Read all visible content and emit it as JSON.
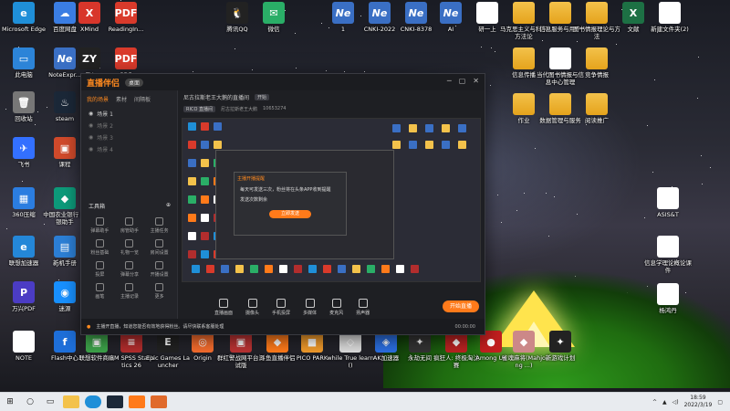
{
  "desktop": {
    "icons": [
      {
        "label": "Microsoft Edge",
        "glyph": "e",
        "cls": "",
        "color": "#1f8fd8"
      },
      {
        "label": "百度网盘",
        "glyph": "☁",
        "cls": "",
        "color": "#3a7de3"
      },
      {
        "label": "XMind",
        "glyph": "X",
        "cls": "",
        "color": "#d8362b"
      },
      {
        "label": "ReadingIn...",
        "glyph": "PDF",
        "cls": "pdf",
        "color": ""
      },
      {
        "label": "此电脑",
        "glyph": "▭",
        "cls": "",
        "color": "#2c84d8"
      },
      {
        "label": "NoteExpr...",
        "glyph": "Ne",
        "cls": "ne",
        "color": ""
      },
      {
        "label": "ZY",
        "glyph": "ZY",
        "cls": "",
        "color": "#222"
      },
      {
        "label": "PDF",
        "glyph": "PDF",
        "cls": "pdf",
        "color": ""
      },
      {
        "label": "回收站",
        "glyph": "🗑",
        "cls": "",
        "color": "#777"
      },
      {
        "label": "steam",
        "glyph": "♨",
        "cls": "",
        "color": "#1b2838"
      },
      {
        "label": "飞书",
        "glyph": "✈",
        "cls": "",
        "color": "#3370ff"
      },
      {
        "label": "课程",
        "glyph": "▣",
        "cls": "",
        "color": "#d04a2b"
      },
      {
        "label": "360压缩",
        "glyph": "▦",
        "cls": "",
        "color": "#2b7de0"
      },
      {
        "label": "中国农业银行 网银助手",
        "glyph": "◆",
        "cls": "",
        "color": "#0d9a7a"
      },
      {
        "label": "联想加速器",
        "glyph": "e",
        "cls": "",
        "color": "#2487d8"
      },
      {
        "label": "新机手册",
        "glyph": "▤",
        "cls": "",
        "color": "#2c7fd6"
      },
      {
        "label": "万兴PDF",
        "glyph": "P",
        "cls": "",
        "color": "#4b3cc4"
      },
      {
        "label": "迷源",
        "glyph": "◉",
        "cls": "",
        "color": "#1890ff"
      },
      {
        "label": "NOTE",
        "glyph": "▤",
        "cls": "doc",
        "color": ""
      },
      {
        "label": "Flash中心",
        "glyph": "f",
        "cls": "",
        "color": "#1e6fd9"
      },
      {
        "label": "联想软件商店",
        "glyph": "▣",
        "cls": "",
        "color": "#3da34a"
      },
      {
        "label": "IBM SPSS Statistics 26",
        "glyph": "≡",
        "cls": "",
        "color": "#b22d2d"
      },
      {
        "label": "Epic Games Launcher",
        "glyph": "E",
        "cls": "",
        "color": "#222"
      },
      {
        "label": "Origin",
        "glyph": "◎",
        "cls": "",
        "color": "#f56c2d"
      },
      {
        "label": "群红警战网平台测试版",
        "glyph": "▣",
        "cls": "",
        "color": "#b33"
      },
      {
        "label": "斗鱼直播伴侣",
        "glyph": "◆",
        "cls": "",
        "color": "#ff7a1a"
      },
      {
        "label": "PICO PARK",
        "glyph": "■",
        "cls": "",
        "color": "#f09a2b"
      },
      {
        "label": "while True learn()",
        "glyph": "◇",
        "cls": "",
        "color": "#ddd"
      },
      {
        "label": "AK加速器",
        "glyph": "◈",
        "cls": "",
        "color": "#2b6ee0"
      },
      {
        "label": "永劫无间",
        "glyph": "✦",
        "cls": "",
        "color": "#333"
      },
      {
        "label": "疯狂人: 终极淘汰赛",
        "glyph": "◆",
        "cls": "",
        "color": "#b22"
      },
      {
        "label": "Among Us",
        "glyph": "●",
        "cls": "",
        "color": "#c21f1f"
      },
      {
        "label": "雀魂麻将(Mahjong ...)",
        "glyph": "◆",
        "cls": "",
        "color": "#c88"
      },
      {
        "label": "新游戏计划",
        "glyph": "✦",
        "cls": "",
        "color": "#222"
      },
      {
        "label": "腾讯QQ",
        "glyph": "🐧",
        "cls": "",
        "color": "#222"
      },
      {
        "label": "微信",
        "glyph": "✉",
        "cls": "",
        "color": "#2aae67"
      },
      {
        "label": "1",
        "glyph": "Ne",
        "cls": "ne",
        "color": ""
      },
      {
        "label": "CNKI-2022",
        "glyph": "Ne",
        "cls": "ne",
        "color": ""
      },
      {
        "label": "CNKI-8378",
        "glyph": "Ne",
        "cls": "ne",
        "color": ""
      },
      {
        "label": "AI",
        "glyph": "Ne",
        "cls": "ne",
        "color": ""
      },
      {
        "label": "研一上",
        "glyph": "▤",
        "cls": "doc",
        "color": ""
      },
      {
        "label": "马克思主义与科学方法论",
        "glyph": "",
        "cls": "folder",
        "color": ""
      },
      {
        "label": "信息服务与用户",
        "glyph": "",
        "cls": "folder",
        "color": ""
      },
      {
        "label": "图书情报理论与方法",
        "glyph": "",
        "cls": "folder",
        "color": ""
      },
      {
        "label": "文献",
        "glyph": "X",
        "cls": "xls",
        "color": ""
      },
      {
        "label": "新建文件夹(2)",
        "glyph": "▤",
        "cls": "doc",
        "color": ""
      },
      {
        "label": "信息传播",
        "glyph": "",
        "cls": "folder",
        "color": ""
      },
      {
        "label": "当代图书情报与信息中心管理",
        "glyph": "▤",
        "cls": "doc",
        "color": ""
      },
      {
        "label": "竞争情报",
        "glyph": "",
        "cls": "folder",
        "color": ""
      },
      {
        "label": "作业",
        "glyph": "",
        "cls": "folder",
        "color": ""
      },
      {
        "label": "数据管理与服务",
        "glyph": "",
        "cls": "folder",
        "color": ""
      },
      {
        "label": "阅读推广",
        "glyph": "",
        "cls": "folder",
        "color": ""
      },
      {
        "label": "ASIS&T",
        "glyph": "W",
        "cls": "doc",
        "color": ""
      },
      {
        "label": "信息学理论概论课件",
        "glyph": "W",
        "cls": "doc",
        "color": ""
      },
      {
        "label": "杨鸿丹",
        "glyph": "W",
        "cls": "doc",
        "color": ""
      }
    ]
  },
  "app": {
    "logo": "直播伴侣",
    "version_tag": "桌面",
    "tabs": [
      "我的场景",
      "素材",
      "间隔板"
    ],
    "scenes": [
      {
        "label": "场景 1",
        "dim": false
      },
      {
        "label": "场景 2",
        "dim": true
      },
      {
        "label": "场景 3",
        "dim": true
      },
      {
        "label": "场景 4",
        "dim": true
      }
    ],
    "toolbox_title": "工具箱",
    "tools": [
      "弹幕助手",
      "房管助手",
      "主播任务",
      "粉丝基础",
      "礼物一览",
      "房间设置",
      "投屏",
      "弹幕分享",
      "开播设置",
      "画笔",
      "主播记录",
      "更多"
    ],
    "room_title": "尼古拉斯老王大鹅的直播间",
    "room_badge": "开始",
    "sub_info": [
      "RICO 直播间",
      "尼古拉斯老王大鹅",
      "10653274"
    ],
    "dialog": {
      "title": "主播开播提醒",
      "message": "每天可发送三次，粉丝将在头条APP收到提醒",
      "sub": "发送次数剩余",
      "button": "立即发送"
    },
    "controls": [
      "直播画面",
      "摄像头",
      "手机投屏",
      "多媒体",
      "麦克风",
      "扬声器"
    ],
    "live_button": "开始直播",
    "status_text": "主播开直播，知道您能否有效地获得粉丝。请尽快联系客服处理",
    "timer": "00:00:00"
  },
  "taskbar": {
    "time": "18:59",
    "date": "2022/3/19"
  }
}
